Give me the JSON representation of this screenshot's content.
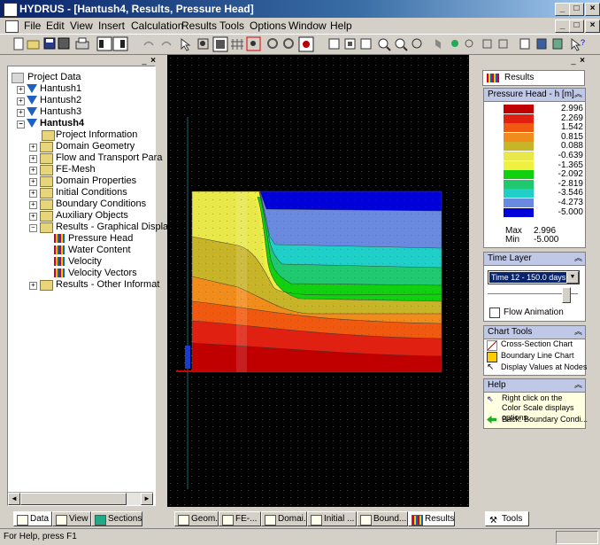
{
  "window": {
    "title": "HYDRUS - [Hantush4, Results, Pressure Head]",
    "controls": [
      "_",
      "□",
      "×"
    ],
    "mdi_controls": [
      "_",
      "□",
      "×"
    ]
  },
  "menu": [
    "File",
    "Edit",
    "View",
    "Insert",
    "Calculation",
    "Results",
    "Tools",
    "Options",
    "Window",
    "Help"
  ],
  "tree": {
    "root": "Project Data",
    "projects": [
      "Hantush1",
      "Hantush2",
      "Hantush3",
      "Hantush4"
    ],
    "items": [
      "Project Information",
      "Domain Geometry",
      "Flow and Transport Para",
      "FE-Mesh",
      "Domain Properties",
      "Initial Conditions",
      "Boundary Conditions",
      "Auxiliary Objects",
      "Results - Graphical Displa"
    ],
    "result_items": [
      "Pressure Head",
      "Water Content",
      "Velocity",
      "Velocity Vectors"
    ],
    "last_item": "Results - Other Informat"
  },
  "left_tabs": [
    "Data",
    "View",
    "Sections"
  ],
  "bottom_tabs": [
    "Geom...",
    "FE-...",
    "Domai...",
    "Initial ...",
    "Bound...",
    "Results"
  ],
  "right_panel": {
    "results_label": "Results",
    "legend_title": "Pressure Head - h [m]",
    "scale": [
      {
        "value": "2.996",
        "color": "#c00000"
      },
      {
        "value": "2.269",
        "color": "#e02010"
      },
      {
        "value": "1.542",
        "color": "#f05a10"
      },
      {
        "value": "0.815",
        "color": "#f08c1c"
      },
      {
        "value": "0.088",
        "color": "#c8b428"
      },
      {
        "value": "-0.639",
        "color": "#e8e84a"
      },
      {
        "value": "-1.365",
        "color": "#f0f040"
      },
      {
        "value": "-2.092",
        "color": "#10d010"
      },
      {
        "value": "-2.819",
        "color": "#20c870"
      },
      {
        "value": "-3.546",
        "color": "#20d0c8"
      },
      {
        "value": "-4.273",
        "color": "#6a8ae0"
      },
      {
        "value": "-5.000",
        "color": "#0000d8"
      }
    ],
    "max_label": "Max",
    "max_value": "2.996",
    "min_label": "Min",
    "min_value": "-5.000",
    "time_layer_title": "Time Layer",
    "time_layer_value": "Time 12 - 150.0 days",
    "flow_animation": "Flow Animation",
    "chart_tools_title": "Chart Tools",
    "chart_tools": [
      "Cross-Section Chart",
      "Boundary Line Chart",
      "Display Values at Nodes"
    ],
    "help_title": "Help",
    "help_text": "Right click on the Color Scale displays options.",
    "help_back": "Back: Boundary Condi...",
    "tools_tab": "Tools"
  },
  "status": "For Help, press F1"
}
